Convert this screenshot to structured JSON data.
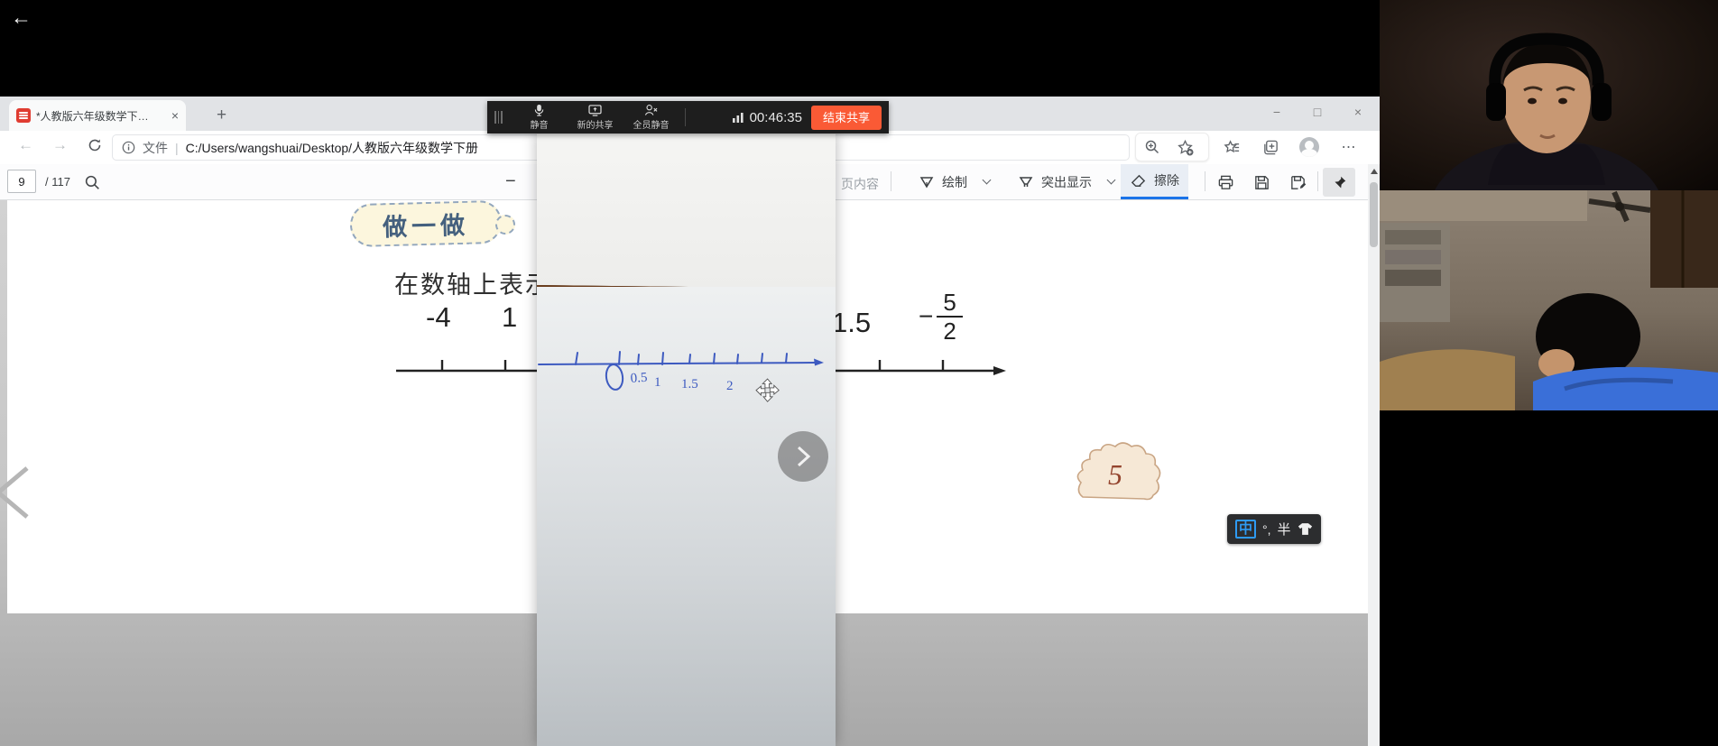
{
  "system": {
    "back_icon": "←"
  },
  "meeting_bar": {
    "mute_label": "静音",
    "new_share_label": "新的共享",
    "mute_all_label": "全员静音",
    "timer": "00:46:35",
    "end_share_label": "结束共享"
  },
  "browser": {
    "tab_title": "*人教版六年级数学下册电子课本",
    "tab_close_icon": "×",
    "new_tab_icon": "+",
    "win_minimize_icon": "−",
    "win_restore_icon": "□",
    "win_close_icon": "×",
    "nav_back_icon": "←",
    "nav_forward_icon": "→",
    "address_scheme_label": "文件",
    "address_divider": "|",
    "address_url": "C:/Users/wangshuai/Desktop/人教版六年级数学下册",
    "more_icon": "⋯"
  },
  "pdf_toolbar": {
    "page_value": "9",
    "page_total_label": "/ 117",
    "zoom_out_icon": "−",
    "read_aloud_truncated_label": "页内容",
    "draw_label": "绘制",
    "highlight_label": "突出显示",
    "erase_label": "擦除"
  },
  "textbook_page": {
    "activity_bubble_label": "做一做",
    "prompt_text": "在数轴上表示",
    "number_neg4": "-4",
    "number_1": "1",
    "number_1_5": "1.5",
    "fraction_sign": "−",
    "fraction_numerator": "5",
    "fraction_denominator": "2",
    "page_badge": "5"
  },
  "shared_phone_video": {
    "handwritten_labels": [
      "0",
      "0.5",
      "1",
      "1.5",
      "2"
    ]
  },
  "viewer_nav": {
    "next_icon": "›",
    "prev_icon": "‹"
  },
  "ime_bar": {
    "lang_mode": "中",
    "punct_mode": "°,",
    "width_mode": "半"
  },
  "colors": {
    "end_share_button": "#fa5a35",
    "erase_active_underline": "#1a73e8",
    "handwriting_ink": "#3d5ac0",
    "pdf_icon_red": "#e03c31"
  }
}
